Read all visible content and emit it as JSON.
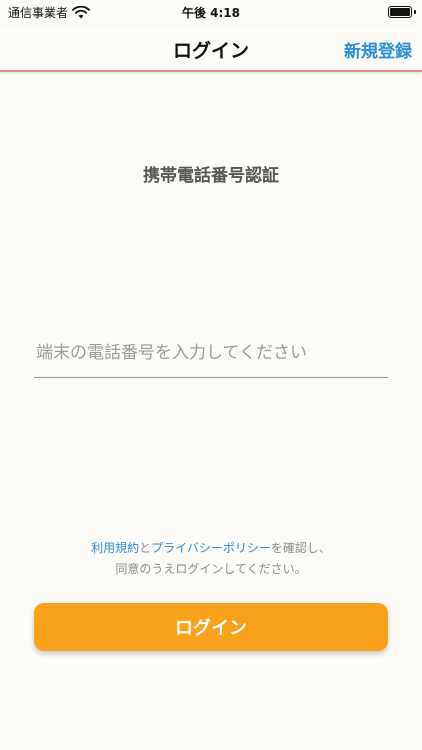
{
  "status_bar": {
    "carrier": "通信事業者",
    "time": "午後 4:18"
  },
  "nav": {
    "title": "ログイン",
    "signup_label": "新規登録"
  },
  "form": {
    "section_title": "携帯電話番号認証",
    "phone_placeholder": "端末の電話番号を入力してください",
    "phone_value": ""
  },
  "terms": {
    "terms_link": "利用規約",
    "and": "と",
    "privacy_link": "プライバシーポリシー",
    "confirm_text": "を確認し、",
    "line2": "同意のうえログインしてください。"
  },
  "login_button_label": "ログイン",
  "colors": {
    "accent_blue": "#2A8FD6",
    "button_orange": "#F9A11B",
    "background": "#FDFBF7"
  }
}
